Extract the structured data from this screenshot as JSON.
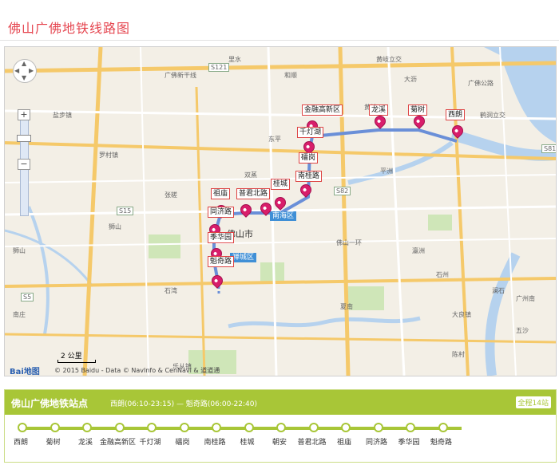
{
  "page": {
    "title": "佛山广佛地铁线路图"
  },
  "map": {
    "station_labels": [
      "金融高新区",
      "龙溪",
      "菊树",
      "西朗",
      "千灯湖",
      "礌岗",
      "南桂路",
      "桂城",
      "普君北路",
      "祖庙",
      "同济路",
      "季华园",
      "魁奇路"
    ],
    "districts": [
      "南海区",
      "禅城区"
    ],
    "city_label": "佛山市",
    "place_labels": [
      "广佛新干线",
      "广佛公路",
      "黄岐立交",
      "大沥",
      "和顺",
      "里水",
      "石湾",
      "张槎",
      "罗村镇",
      "狮山",
      "南庄",
      "乐从镇",
      "陈村",
      "石州",
      "平洲",
      "夏南",
      "黄岐",
      "大良镇",
      "盐步镇",
      "东平",
      "澜石",
      "瀛洲",
      "五沙",
      "佛山一环",
      "狮山",
      "双蒸",
      "鹤洞立交",
      "广州南"
    ],
    "road_badges": [
      "S121",
      "S15",
      "S82",
      "S81",
      "S5"
    ],
    "scale_text": "2 公里",
    "logo_text": "Bai",
    "logo_text2": "地图",
    "copyright": "© 2015 Baidu - Data © NavInfo & CenNavi & 道道通"
  },
  "panel": {
    "title": "佛山广佛地铁站点",
    "times": "西朗(06:10-23:15)  —  魁奇路(06:00-22:40)",
    "badge": "全程14站",
    "stations": [
      "西朗",
      "菊树",
      "龙溪",
      "金融高新区",
      "千灯湖",
      "礌岗",
      "南桂路",
      "桂城",
      "朝安",
      "普君北路",
      "祖庙",
      "同济路",
      "季华园",
      "魁奇路"
    ]
  },
  "colors": {
    "title": "#e5454f",
    "line": "#a8c637",
    "route": "#6a8fd8",
    "pin": "#d81e6b"
  }
}
